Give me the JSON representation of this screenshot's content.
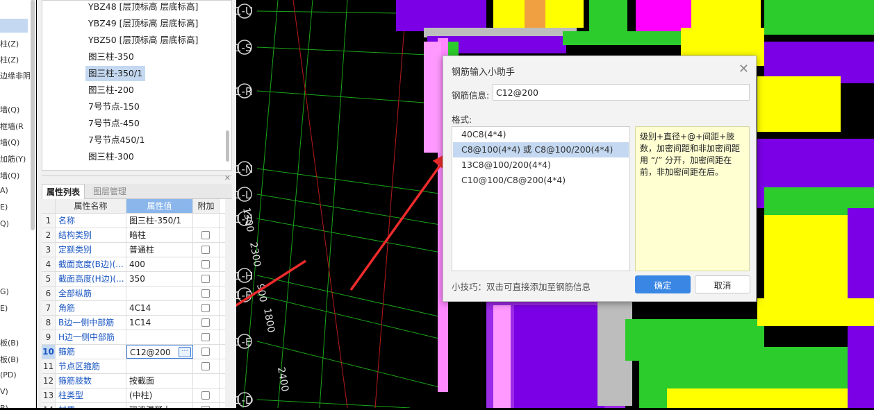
{
  "left_strip": [
    "柱(Z)",
    "柱(Z)",
    "边缘非阴",
    "墙(Q)",
    "框墙(R",
    "墙(Q)",
    "加筋(Y)",
    "墙(Q)",
    "A)",
    "E)",
    "Q)",
    "G)",
    "E)",
    "板(B)",
    "板(B)",
    "(PD)",
    "V)",
    "B)"
  ],
  "tree_items": [
    "YBZ48 [层顶标高 层底标高]",
    "YBZ49 [层顶标高 层底标高]",
    "YBZ50 [层顶标高 层底标高]",
    "图三柱-350",
    "图三柱-350/1",
    "图三柱-200",
    "7号节点-150",
    "7号节点-450",
    "7号节点450/1",
    "图三柱-300"
  ],
  "tabs": {
    "properties": "属性列表",
    "layers": "图层管理"
  },
  "prop_headers": {
    "name": "属性名称",
    "value": "属性值",
    "extra": "附加"
  },
  "prop_rows": [
    {
      "num": "1",
      "name": "名称",
      "value": "图三柱-350/1",
      "check": false
    },
    {
      "num": "2",
      "name": "结构类别",
      "value": "暗柱",
      "check": true
    },
    {
      "num": "3",
      "name": "定额类别",
      "value": "普通柱",
      "check": true
    },
    {
      "num": "4",
      "name": "截面宽度(B边)(...",
      "value": "400",
      "check": true
    },
    {
      "num": "5",
      "name": "截面高度(H边)(...",
      "value": "350",
      "check": true
    },
    {
      "num": "6",
      "name": "全部纵筋",
      "value": "",
      "check": true
    },
    {
      "num": "7",
      "name": "角筋",
      "value": "4C14",
      "check": true
    },
    {
      "num": "8",
      "name": "B边一侧中部筋",
      "value": "1C14",
      "check": true
    },
    {
      "num": "9",
      "name": "H边一侧中部筋",
      "value": "",
      "check": true
    },
    {
      "num": "10",
      "name": "箍筋",
      "value": "C12@200",
      "check": true
    },
    {
      "num": "11",
      "name": "节点区箍筋",
      "value": "",
      "check": true
    },
    {
      "num": "12",
      "name": "箍筋肢数",
      "value": "按截面",
      "check": false
    },
    {
      "num": "13",
      "name": "柱类型",
      "value": "(中柱)",
      "check": true
    },
    {
      "num": "14",
      "name": "材质",
      "value": "现浇混凝土",
      "check": true
    }
  ],
  "cad": {
    "axis_labels": [
      "1-U",
      "1-S",
      "1-R",
      "1-N",
      "1-L",
      "1-J",
      "1-H",
      "1-F",
      "1-E",
      "1-D"
    ],
    "dims": [
      "2300",
      "1800",
      "2400",
      "900",
      "1300"
    ]
  },
  "dialog": {
    "title": "钢筋输入小助手",
    "info_label": "钢筋信息:",
    "info_value": "C12@200",
    "format_label": "格式:",
    "formats": [
      "40C8(4*4)",
      "C8@100(4*4) 或 C8@100/200(4*4)",
      "13C8@100/200(4*4)",
      "C10@100/C8@200(4*4)"
    ],
    "selected_format": 1,
    "description": "级别+直径+@+间距+肢数，加密间距和非加密间距用 “/” 分开，加密间距在前，非加密间距在后。",
    "tip": "小技巧：双击可直接添加至钢筋信息",
    "ok": "确定",
    "cancel": "取消"
  }
}
